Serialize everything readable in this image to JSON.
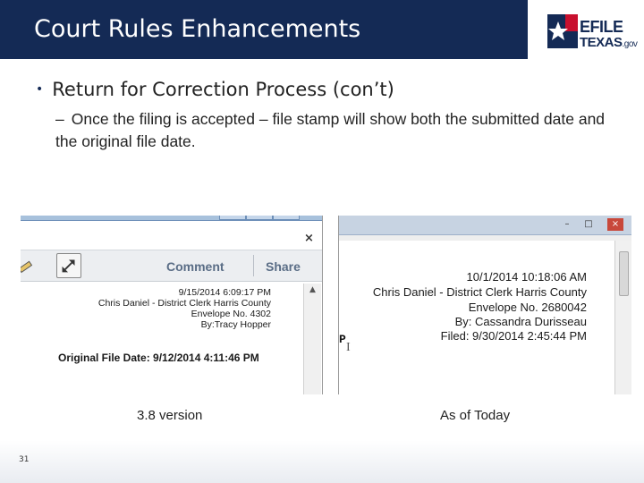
{
  "header": {
    "title": "Court Rules Enhancements",
    "logo": {
      "line1": "EFILE",
      "line2": "TEXAS",
      "line2_suffix": ".gov",
      "icon": "texas-star-icon"
    }
  },
  "content": {
    "bullet1": "Return for Correction Process (con’t)",
    "bullet2_dash": "–",
    "bullet2": "Once the filing is accepted – file stamp will show both the submitted date and the original file date."
  },
  "left_screenshot": {
    "toolbar": {
      "comment_label": "Comment",
      "share_label": "Share",
      "close_label": "×"
    },
    "stamp": {
      "line1": "9/15/2014 6:09:17 PM",
      "line2": "Chris Daniel - District Clerk Harris County",
      "line3": "Envelope No. 4302",
      "line4": "By:Tracy Hopper"
    },
    "original_file_date": "Original File Date: 9/12/2014 4:11:46 PM",
    "caption": "3.8 version"
  },
  "right_screenshot": {
    "window_buttons": {
      "minimize": "–",
      "maximize": "□",
      "close": "×"
    },
    "stamp": {
      "line1": "10/1/2014 10:18:06 AM",
      "line2": "Chris Daniel - District Clerk Harris County",
      "line3": "Envelope No. 2680042",
      "line4": "By: Cassandra Durisseau",
      "line5": "Filed: 9/30/2014 2:45:44 PM"
    },
    "cursor_text": "P",
    "caption": "As of Today"
  },
  "footer": {
    "page_number": "31"
  },
  "colors": {
    "header_band": "#142a55",
    "logo_red": "#c8102e",
    "toolbar_text": "#5a6d86"
  }
}
